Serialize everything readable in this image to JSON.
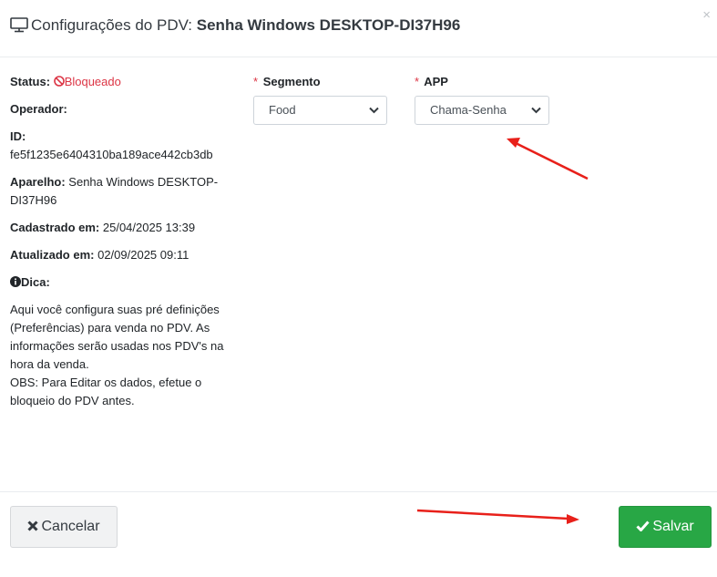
{
  "modal": {
    "title_prefix": "Configurações do PDV:",
    "title_device": "Senha Windows DESKTOP-DI37H96",
    "close_symbol": "×"
  },
  "info": {
    "status_label": "Status:",
    "status_value": "Bloqueado",
    "operator_label": "Operador:",
    "id_label": "ID:",
    "id_value": "fe5f1235e6404310ba189ace442cb3db",
    "device_label": "Aparelho:",
    "device_value_line1": "Senha Windows DESKTOP-",
    "device_value_line2": "DI37H96",
    "registered_label": "Cadastrado em:",
    "registered_value": "25/04/2025 13:39",
    "updated_label": "Atualizado em:",
    "updated_value": "02/09/2025 09:11",
    "tip_label": "Dica:",
    "tip_lines": [
      "Aqui você configura suas pré definições",
      "(Preferências) para venda no PDV. As",
      "informações serão usadas nos PDV's na",
      "hora da venda.",
      "OBS: Para Editar os dados, efetue o",
      "bloqueio do PDV antes."
    ]
  },
  "form": {
    "required_mark": "*",
    "segment_label": "Segmento",
    "segment_value": "Food",
    "app_label": "APP",
    "app_value": "Chama-Senha"
  },
  "footer": {
    "cancel_label": "Cancelar",
    "save_label": "Salvar"
  },
  "colors": {
    "danger": "#dc3545",
    "success": "#28a745",
    "annotation_arrow": "#e8201a"
  },
  "icons": [
    "monitor-icon",
    "ban-icon",
    "info-circle-icon",
    "chevron-down-icon",
    "times-icon",
    "check-icon"
  ]
}
